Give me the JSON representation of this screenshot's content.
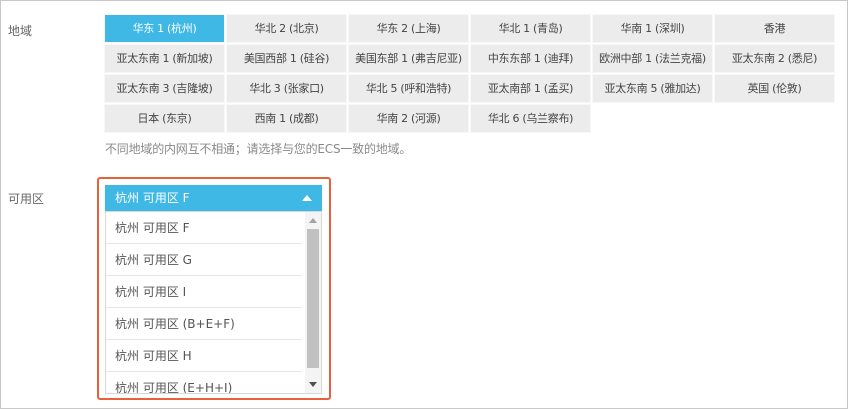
{
  "region": {
    "label": "地域",
    "rows": [
      [
        "华东 1 (杭州)",
        "华北 2 (北京)",
        "华东 2 (上海)",
        "华北 1 (青岛)",
        "华南 1 (深圳)",
        "香港"
      ],
      [
        "亚太东南 1 (新加坡)",
        "美国西部 1 (硅谷)",
        "美国东部 1 (弗吉尼亚)",
        "中东东部 1 (迪拜)",
        "欧洲中部 1 (法兰克福)",
        "亚太东南 2 (悉尼)"
      ],
      [
        "亚太东南 3 (吉隆坡)",
        "华北 3 (张家口)",
        "华北 5 (呼和浩特)",
        "亚太南部 1 (孟买)",
        "亚太东南 5 (雅加达)",
        "英国 (伦敦)"
      ],
      [
        "日本 (东京)",
        "西南 1 (成都)",
        "华南 2 (河源)",
        "华北 6 (乌兰察布)"
      ]
    ],
    "selected": "华东 1 (杭州)",
    "hint": "不同地域的内网互不相通；请选择与您的ECS一致的地域。"
  },
  "zone": {
    "label": "可用区",
    "selected": "杭州 可用区 F",
    "options": [
      "杭州 可用区 F",
      "杭州 可用区 G",
      "杭州 可用区 I",
      "杭州 可用区 (B+E+F)",
      "杭州 可用区 H",
      "杭州 可用区 (E+H+I)"
    ]
  },
  "colors": {
    "accent": "#3fb8e6",
    "highlight": "#e8603c",
    "button_bg": "#ececec"
  },
  "icons": {
    "dropdown_toggle": "caret-up-icon",
    "scroll_up": "scroll-up-arrow-icon",
    "scroll_down": "scroll-down-arrow-icon"
  }
}
